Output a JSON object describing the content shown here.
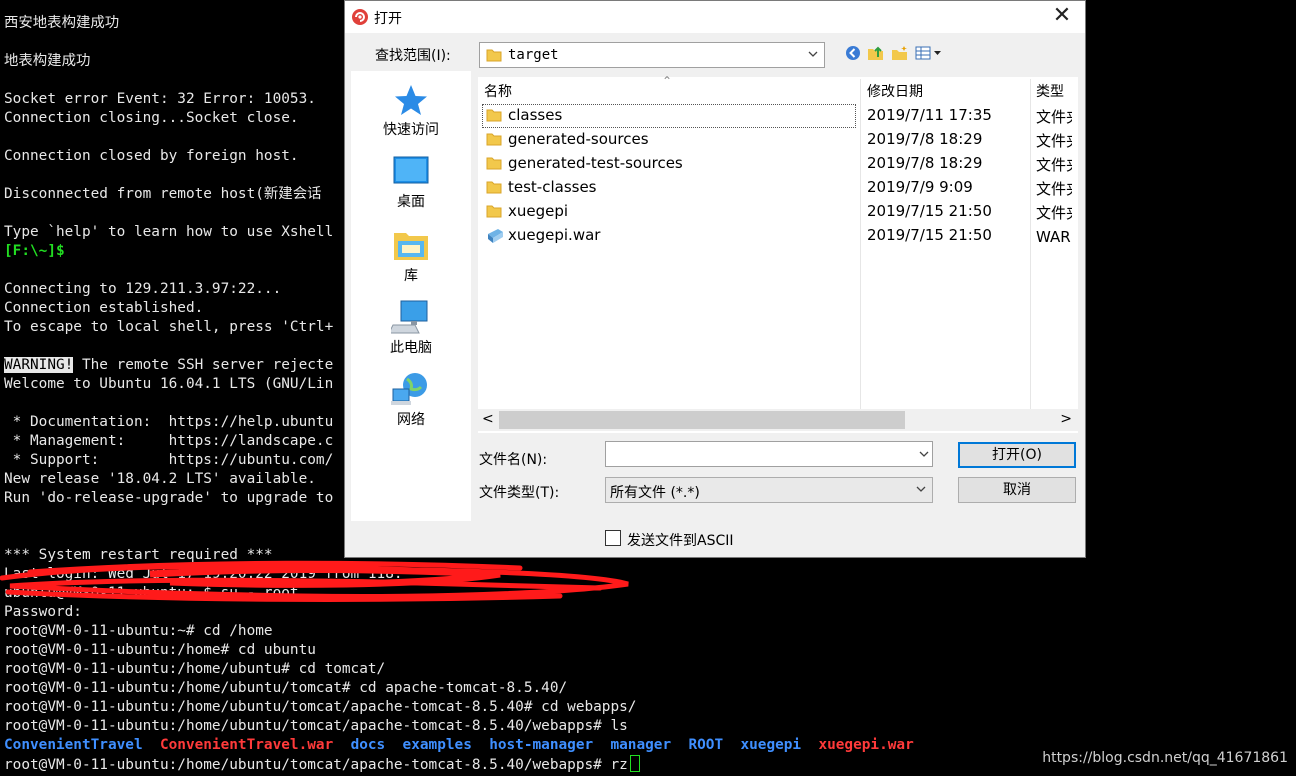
{
  "terminal": {
    "lines": [
      "西安地表构建成功",
      "地表构建成功",
      "Socket error Event: 32 Error: 10053.",
      "Connection closing...Socket close.",
      "Connection closed by foreign host.",
      "Disconnected from remote host(新建会话",
      "Type `help' to learn how to use Xshell",
      "Connecting to 129.211.3.97:22...",
      "Connection established.",
      "To escape to local shell, press 'Ctrl+",
      "WARNING!",
      " The remote SSH server rejecte",
      "Welcome to Ubuntu 16.04.1 LTS (GNU/Lin",
      " * Documentation:  https://help.ubuntu",
      " * Management:     https://landscape.c",
      " * Support:        https://ubuntu.com/",
      "New release '18.04.2 LTS' available.",
      "Run 'do-release-upgrade' to upgrade to",
      "*** System restart required ***",
      "Last login: Wed Jul 17 19:20:22 2019 from 118.",
      "ubuntu@VM-0-11-ubuntu:~$ su - root",
      "Password:",
      "root@VM-0-11-ubuntu:~# cd /home",
      "root@VM-0-11-ubuntu:/home# cd ubuntu",
      "root@VM-0-11-ubuntu:/home/ubuntu# cd tomcat/",
      "root@VM-0-11-ubuntu:/home/ubuntu/tomcat# cd apache-tomcat-8.5.40/",
      "root@VM-0-11-ubuntu:/home/ubuntu/tomcat/apache-tomcat-8.5.40# cd webapps/",
      "root@VM-0-11-ubuntu:/home/ubuntu/tomcat/apache-tomcat-8.5.40/webapps# ls",
      "root@VM-0-11-ubuntu:/home/ubuntu/tomcat/apache-tomcat-8.5.40/webapps# rz"
    ],
    "prompt_local": "[F:\\~]$",
    "ls_output": [
      {
        "name": "ConvenientTravel",
        "kind": "dir"
      },
      {
        "name": "ConvenientTravel.war",
        "kind": "archive"
      },
      {
        "name": "docs",
        "kind": "dir"
      },
      {
        "name": "examples",
        "kind": "dir"
      },
      {
        "name": "host-manager",
        "kind": "dir"
      },
      {
        "name": "manager",
        "kind": "dir"
      },
      {
        "name": "ROOT",
        "kind": "dir"
      },
      {
        "name": "xuegepi",
        "kind": "dir"
      },
      {
        "name": "xuegepi.war",
        "kind": "archive"
      }
    ],
    "watermark": "https://blog.csdn.net/qq_41671861",
    "colors": {
      "dir": "#3f8fff",
      "archive": "#ff3a3a",
      "prompt": "#22dd22",
      "scribble": "#ff1a1a"
    }
  },
  "dialog": {
    "title": "打开",
    "app_icon": "xshell-icon",
    "close_glyph": "✕",
    "lookin_label": "查找范围(I):",
    "lookin_value": "target",
    "places": [
      {
        "label": "快速访问",
        "icon": "quick-access-star-icon"
      },
      {
        "label": "桌面",
        "icon": "desktop-icon"
      },
      {
        "label": "库",
        "icon": "library-icon"
      },
      {
        "label": "此电脑",
        "icon": "this-pc-icon"
      },
      {
        "label": "网络",
        "icon": "network-icon"
      }
    ],
    "columns": {
      "name": "名称",
      "date": "修改日期",
      "type": "类型"
    },
    "files": [
      {
        "name": "classes",
        "date": "2019/7/11 17:35",
        "type": "文件夹",
        "icon": "folder-icon"
      },
      {
        "name": "generated-sources",
        "date": "2019/7/8 18:29",
        "type": "文件夹",
        "icon": "folder-icon"
      },
      {
        "name": "generated-test-sources",
        "date": "2019/7/8 18:29",
        "type": "文件夹",
        "icon": "folder-icon"
      },
      {
        "name": "test-classes",
        "date": "2019/7/9 9:09",
        "type": "文件夹",
        "icon": "folder-icon"
      },
      {
        "name": "xuegepi",
        "date": "2019/7/15 21:50",
        "type": "文件夹",
        "icon": "folder-icon"
      },
      {
        "name": "xuegepi.war",
        "date": "2019/7/15 21:50",
        "type": "WAR 文件",
        "icon": "war-file-icon"
      }
    ],
    "filename_label": "文件名(N):",
    "filename_value": "",
    "filetype_label": "文件类型(T):",
    "filetype_value": "所有文件 (*.*)",
    "open_button": "打开(O)",
    "cancel_button": "取消",
    "ascii_checkbox_label": "发送文件到ASCII",
    "ascii_checked": false,
    "accent": "#0078d7"
  }
}
